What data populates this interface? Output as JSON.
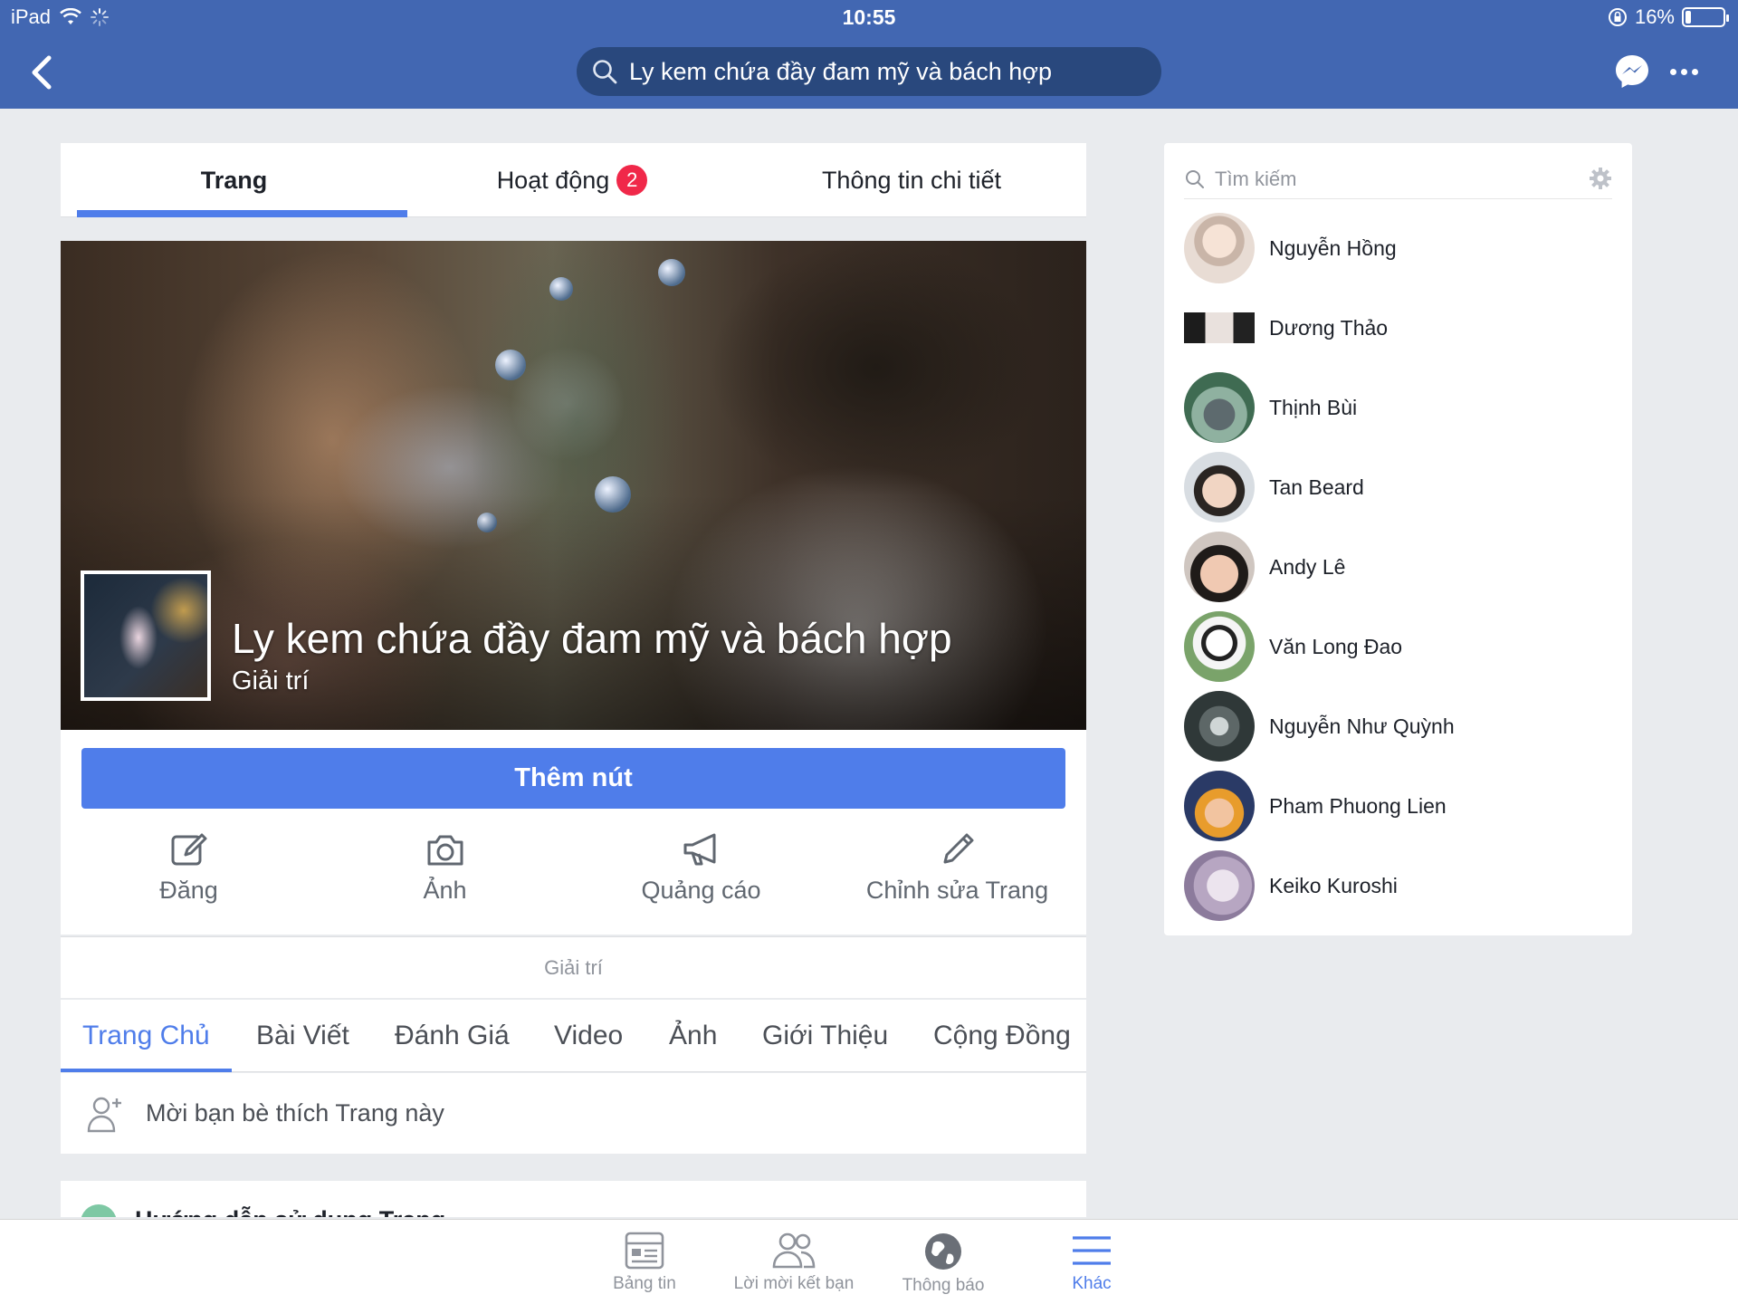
{
  "status_bar": {
    "device": "iPad",
    "time": "10:55",
    "battery": "16%",
    "battery_level": 0.16
  },
  "header": {
    "search_text": "Ly kem chứa đầy đam mỹ và bách hợp",
    "icons": [
      "back-chevron-icon",
      "search-icon",
      "messenger-icon",
      "more-icon"
    ]
  },
  "page_tabs": [
    {
      "label": "Trang",
      "active": true
    },
    {
      "label": "Hoạt động",
      "badge": "2"
    },
    {
      "label": "Thông tin chi tiết"
    }
  ],
  "page": {
    "title": "Ly kem chứa đầy đam mỹ và bách hợp",
    "category": "Giải trí",
    "add_button": "Thêm nút",
    "actions": [
      {
        "label": "Đăng",
        "icon": "edit-icon"
      },
      {
        "label": "Ảnh",
        "icon": "camera-icon"
      },
      {
        "label": "Quảng cáo",
        "icon": "megaphone-icon"
      },
      {
        "label": "Chỉnh sửa Trang",
        "icon": "pencil-icon"
      }
    ],
    "category_line": "Giải trí"
  },
  "nav_tabs": [
    {
      "label": "Trang Chủ",
      "active": true
    },
    {
      "label": "Bài Viết"
    },
    {
      "label": "Đánh Giá"
    },
    {
      "label": "Video"
    },
    {
      "label": "Ảnh"
    },
    {
      "label": "Giới Thiệu"
    },
    {
      "label": "Cộng Đồng"
    }
  ],
  "invite": {
    "text": "Mời bạn bè thích Trang này"
  },
  "guide": {
    "title": "Hướng dẫn sử dụng Trang"
  },
  "sidebar": {
    "search_placeholder": "Tìm kiếm",
    "friends": [
      {
        "name": "Nguyễn Hồng"
      },
      {
        "name": "Dương Thảo"
      },
      {
        "name": "Thịnh Bùi"
      },
      {
        "name": "Tan Beard"
      },
      {
        "name": "Andy Lê"
      },
      {
        "name": "Văn Long Đao"
      },
      {
        "name": "Nguyễn Như Quỳnh"
      },
      {
        "name": "Pham Phuong Lien"
      },
      {
        "name": "Keiko Kuroshi"
      }
    ]
  },
  "tabbar": [
    {
      "label": "Bảng tin",
      "icon": "news-feed-icon"
    },
    {
      "label": "Lời mời kết bạn",
      "icon": "friend-requests-icon"
    },
    {
      "label": "Thông báo",
      "icon": "globe-icon"
    },
    {
      "label": "Khác",
      "icon": "menu-icon",
      "active": true
    }
  ],
  "colors": {
    "brand_blue": "#4267b2",
    "accent_blue": "#4f7dea",
    "badge_red": "#f02849",
    "background": "#e9ebee"
  }
}
